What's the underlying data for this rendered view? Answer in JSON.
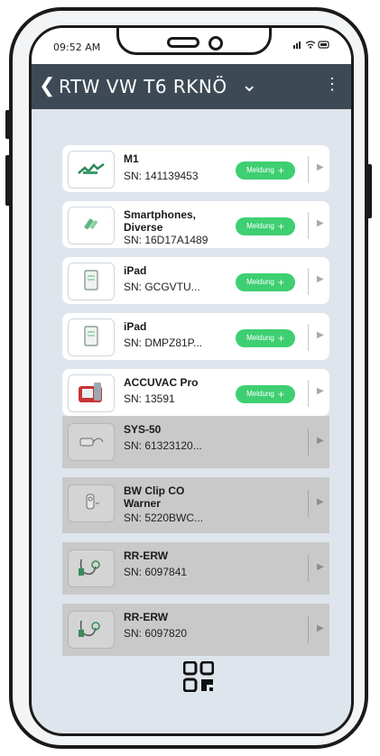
{
  "status_bar": {
    "time": "09:52 AM",
    "icons": "signal-wifi-battery"
  },
  "header": {
    "back_icon": "chevron-left-icon",
    "title": "RTW VW T6 RKNÖ",
    "menu_icon": "kebab-icon"
  },
  "devices": [
    {
      "name": "M1",
      "sn": "SN: 141139453",
      "action": "Meldung",
      "active": true,
      "icon": "monitor-icon"
    },
    {
      "name": "Smartphones, Diverse",
      "sn": "SN: 16D17A1489",
      "action": "Meldung",
      "active": true,
      "icon": "phones-icon"
    },
    {
      "name": "iPad",
      "sn": "SN: GCGVTU...",
      "action": "Meldung",
      "active": true,
      "icon": "tablet-icon"
    },
    {
      "name": "iPad",
      "sn": "SN: DMPZ81P...",
      "action": "Meldung",
      "active": true,
      "icon": "tablet-icon"
    },
    {
      "name": "ACCUVAC Pro",
      "sn": "SN: 13591",
      "action": "Meldung",
      "active": true,
      "icon": "suction-icon"
    },
    {
      "name": "SYS-50",
      "sn": "SN: 61323120...",
      "active": false,
      "icon": "meter-icon"
    },
    {
      "name": "BW Clip CO Warner",
      "sn": "SN: 5220BWC...",
      "active": false,
      "icon": "sensor-icon"
    },
    {
      "name": "RR-ERW",
      "sn": "SN: 6097841",
      "active": false,
      "icon": "bp-cuff-icon"
    },
    {
      "name": "RR-ERW",
      "sn": "SN: 6097820",
      "active": false,
      "icon": "bp-cuff-icon"
    }
  ],
  "footer": {
    "qr_icon": "qr-scan-icon"
  }
}
